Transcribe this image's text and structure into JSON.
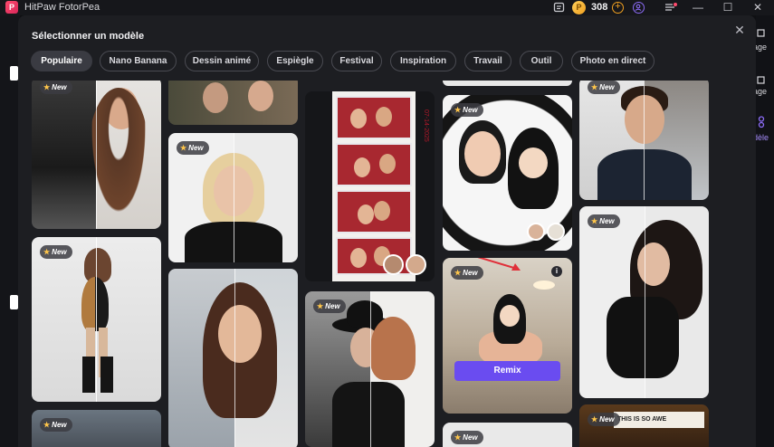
{
  "app": {
    "title": "HitPaw FotorPea",
    "logo_letter": "P",
    "coins": "308",
    "coin_symbol": "P",
    "window_controls": [
      "—",
      "☐",
      "✕"
    ]
  },
  "background": {
    "right_labels": [
      "age",
      "age",
      "dèle"
    ]
  },
  "modal": {
    "title": "Sélectionner un modèle",
    "close_symbol": "✕",
    "tabs": [
      {
        "label": "Populaire",
        "active": true
      },
      {
        "label": "Nano Banana",
        "active": false
      },
      {
        "label": "Dessin animé",
        "active": false
      },
      {
        "label": "Espiègle",
        "active": false
      },
      {
        "label": "Festival",
        "active": false
      },
      {
        "label": "Inspiration",
        "active": false
      },
      {
        "label": "Travail",
        "active": false
      },
      {
        "label": "Outil",
        "active": false
      },
      {
        "label": "Photo en direct",
        "active": false
      }
    ],
    "badge_new": "New",
    "badge_star": "★",
    "remix_label": "Remix",
    "info_symbol": "i",
    "photo_strip_side_text": "07-14-2025",
    "cafe_sign_text": "THIS IS SO AWE"
  },
  "colors": {
    "accent": "#6a4cf0",
    "coin": "#f0a020",
    "badge_star": "#ffc64a",
    "arrow": "#e0303a"
  }
}
